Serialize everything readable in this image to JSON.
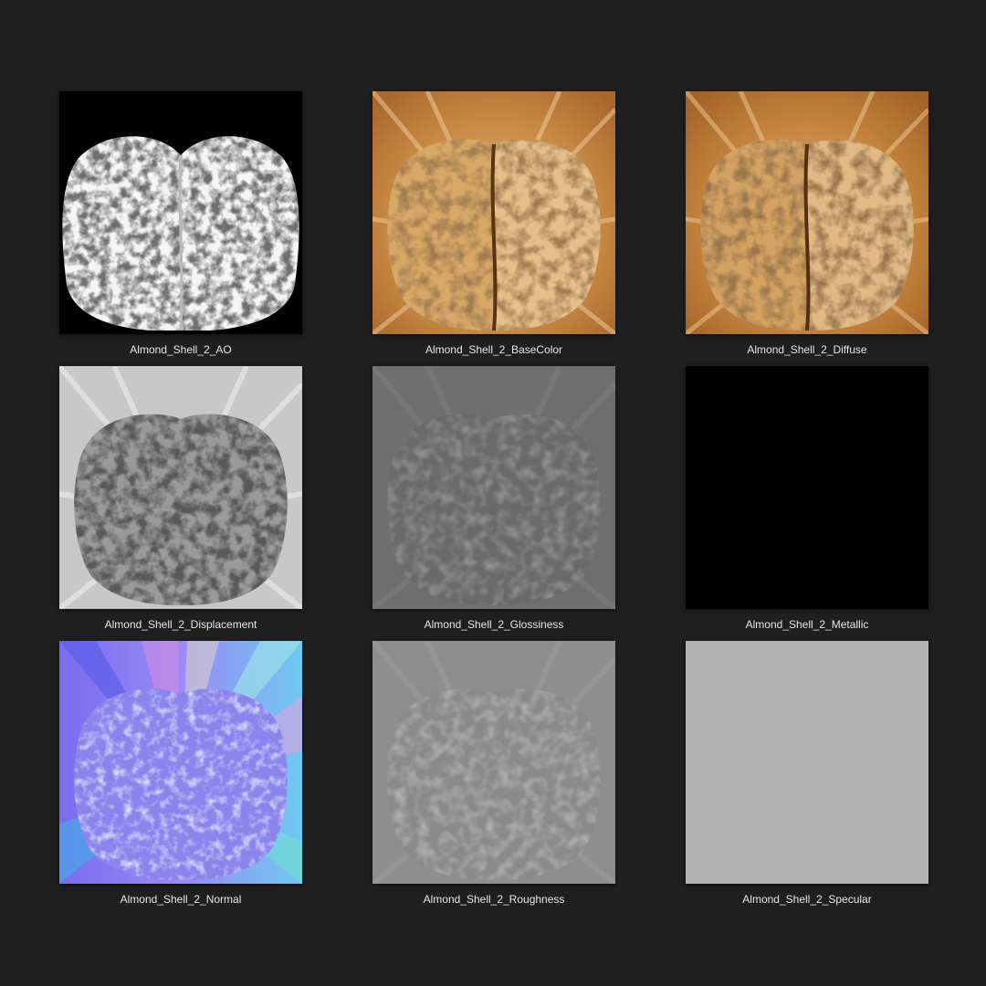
{
  "background_color": "#1f1f1f",
  "textures": [
    {
      "label": "Almond_Shell_2_AO",
      "map": "ao"
    },
    {
      "label": "Almond_Shell_2_BaseColor",
      "map": "basecolor"
    },
    {
      "label": "Almond_Shell_2_Diffuse",
      "map": "diffuse"
    },
    {
      "label": "Almond_Shell_2_Displacement",
      "map": "displacement"
    },
    {
      "label": "Almond_Shell_2_Glossiness",
      "map": "glossiness"
    },
    {
      "label": "Almond_Shell_2_Metallic",
      "map": "metallic"
    },
    {
      "label": "Almond_Shell_2_Normal",
      "map": "normal"
    },
    {
      "label": "Almond_Shell_2_Roughness",
      "map": "roughness"
    },
    {
      "label": "Almond_Shell_2_Specular",
      "map": "specular"
    }
  ]
}
